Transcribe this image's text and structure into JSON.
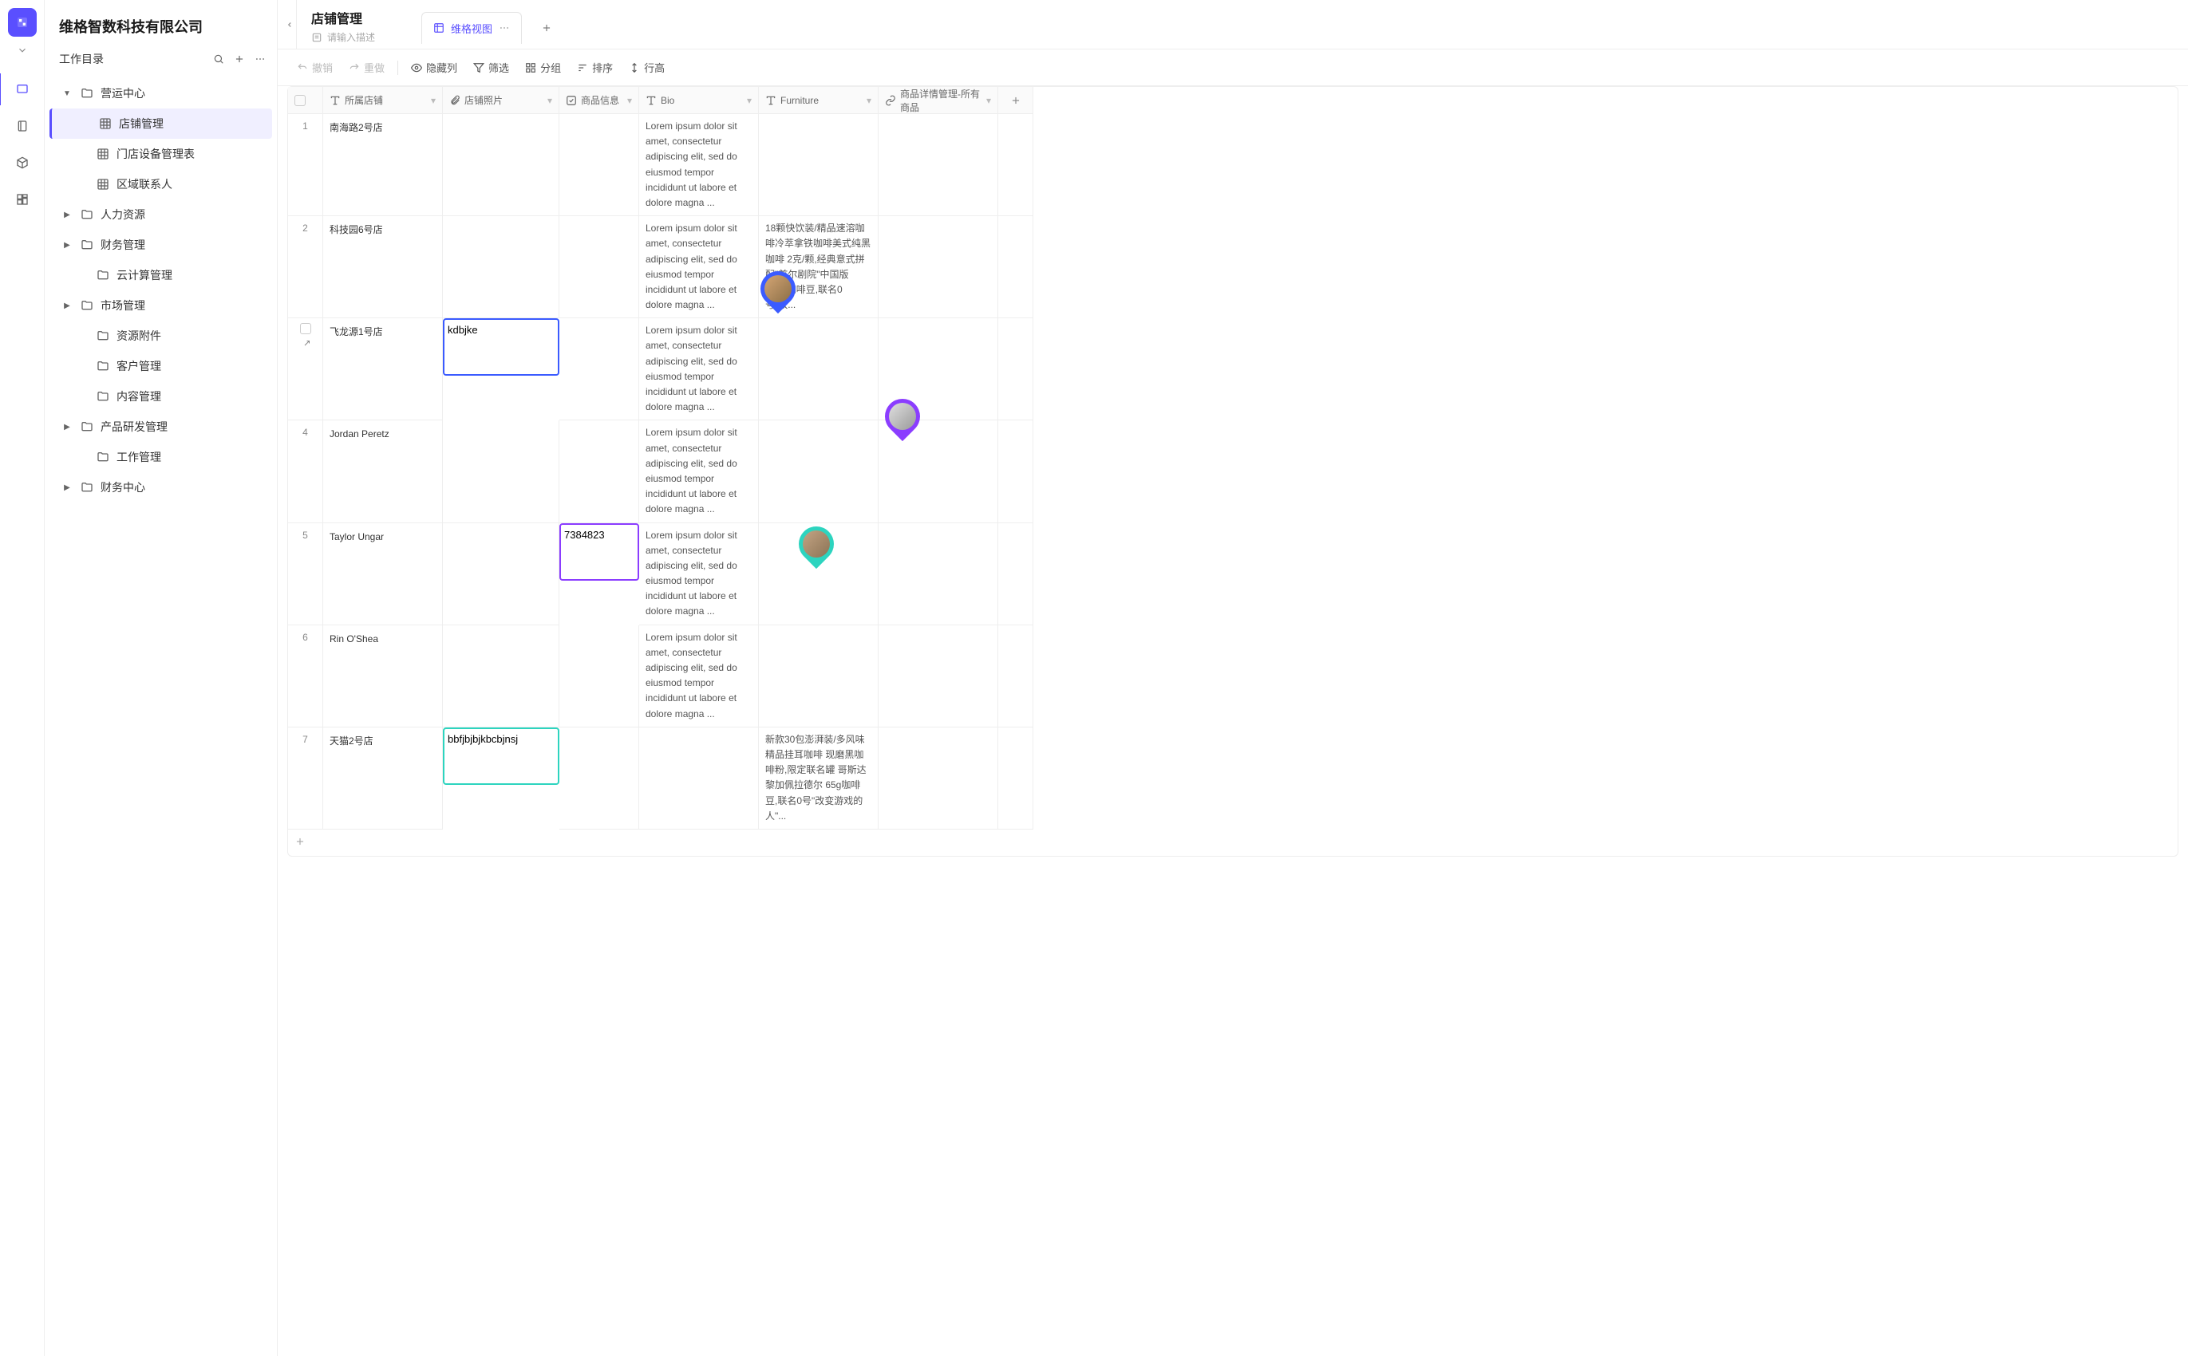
{
  "org_name": "维格智数科技有限公司",
  "workspace_label": "工作目录",
  "sidebar": {
    "items": [
      {
        "label": "营运中心",
        "expanded": true,
        "icon": "folder",
        "level": 0,
        "caret": true
      },
      {
        "label": "店铺管理",
        "icon": "grid",
        "level": 1,
        "selected": true
      },
      {
        "label": "门店设备管理表",
        "icon": "grid",
        "level": 1
      },
      {
        "label": "区域联系人",
        "icon": "grid",
        "level": 1
      },
      {
        "label": "人力资源",
        "icon": "folder",
        "level": 0,
        "caret": true,
        "collapsed": true
      },
      {
        "label": "财务管理",
        "icon": "folder",
        "level": 0,
        "caret": true,
        "collapsed": true
      },
      {
        "label": "云计算管理",
        "icon": "folder",
        "level": 2
      },
      {
        "label": "市场管理",
        "icon": "folder",
        "level": 0,
        "caret": true,
        "collapsed": true
      },
      {
        "label": "资源附件",
        "icon": "folder",
        "level": 2
      },
      {
        "label": "客户管理",
        "icon": "folder",
        "level": 2
      },
      {
        "label": "内容管理",
        "icon": "folder",
        "level": 2
      },
      {
        "label": "产品研发管理",
        "icon": "folder",
        "level": 0,
        "caret": true,
        "collapsed": true
      },
      {
        "label": "工作管理",
        "icon": "folder",
        "level": 2
      },
      {
        "label": "财务中心",
        "icon": "folder",
        "level": 0,
        "caret": true,
        "collapsed": true
      }
    ]
  },
  "page": {
    "title": "店铺管理",
    "desc_placeholder": "请输入描述"
  },
  "tabs": {
    "active": {
      "label": "维格视图",
      "icon": "grid-view"
    }
  },
  "toolbar": {
    "undo": "撤销",
    "redo": "重做",
    "hide_cols": "隐藏列",
    "filter": "筛选",
    "group": "分组",
    "sort": "排序",
    "row_height": "行高"
  },
  "columns": [
    {
      "key": "check",
      "type": "checkbox"
    },
    {
      "key": "store",
      "label": "所属店铺",
      "icon": "text"
    },
    {
      "key": "photo",
      "label": "店铺照片",
      "icon": "attachment"
    },
    {
      "key": "goods",
      "label": "商品信息",
      "icon": "check"
    },
    {
      "key": "bio",
      "label": "Bio",
      "icon": "text"
    },
    {
      "key": "furniture",
      "label": "Furniture",
      "icon": "text"
    },
    {
      "key": "detail",
      "label": "商品详情管理-所有商品",
      "icon": "link"
    },
    {
      "key": "add",
      "type": "add"
    }
  ],
  "rows": [
    {
      "idx": 1,
      "store": "南海路2号店",
      "bio": "Lorem ipsum dolor sit amet, consectetur adipiscing elit, sed do eiusmod tempor incididunt ut labore et dolore magna ..."
    },
    {
      "idx": 2,
      "store": "科技园6号店",
      "bio": "Lorem ipsum dolor sit amet, consectetur adipiscing elit, sed do eiusmod tempor incididunt ut labore et dolore magna ...",
      "furniture": "18颗快饮装/精品速溶咖啡冷萃拿铁咖啡美式纯黑咖啡 2克/颗,经典意式拼配\"首尔剧院\"中国版 250g咖啡豆,联名0号\"改..."
    },
    {
      "idx": 3,
      "store": "飞龙源1号店",
      "photo_edit": "kdbjke",
      "bio": "Lorem ipsum dolor sit amet, consectetur adipiscing elit, sed do eiusmod tempor incididunt ut labore et dolore magna ..."
    },
    {
      "idx": 4,
      "store": "Jordan Peretz",
      "bio": "Lorem ipsum dolor sit amet, consectetur adipiscing elit, sed do eiusmod tempor incididunt ut labore et dolore magna ..."
    },
    {
      "idx": 5,
      "store": "Taylor Ungar",
      "goods_edit": "7384823",
      "bio": "Lorem ipsum dolor sit amet, consectetur adipiscing elit, sed do eiusmod tempor incididunt ut labore et dolore magna ..."
    },
    {
      "idx": 6,
      "store": "Rin O'Shea",
      "bio": "Lorem ipsum dolor sit amet, consectetur adipiscing elit, sed do eiusmod tempor incididunt ut labore et dolore magna ..."
    },
    {
      "idx": 7,
      "store": "天猫2号店",
      "photo_edit2": "bbfjbjbjkbcbjnsj",
      "furniture": "新款30包澎湃装/多风味精品挂耳咖啡 现磨黑咖啡粉,限定联名罐 哥斯达黎加佩拉德尔 65g咖啡豆,联名0号\"改变游戏的人\"..."
    }
  ],
  "cursors": {
    "blue": {
      "color": "#3b5bff"
    },
    "purple": {
      "color": "#8b3dff"
    },
    "teal": {
      "color": "#2dd4bf"
    }
  }
}
